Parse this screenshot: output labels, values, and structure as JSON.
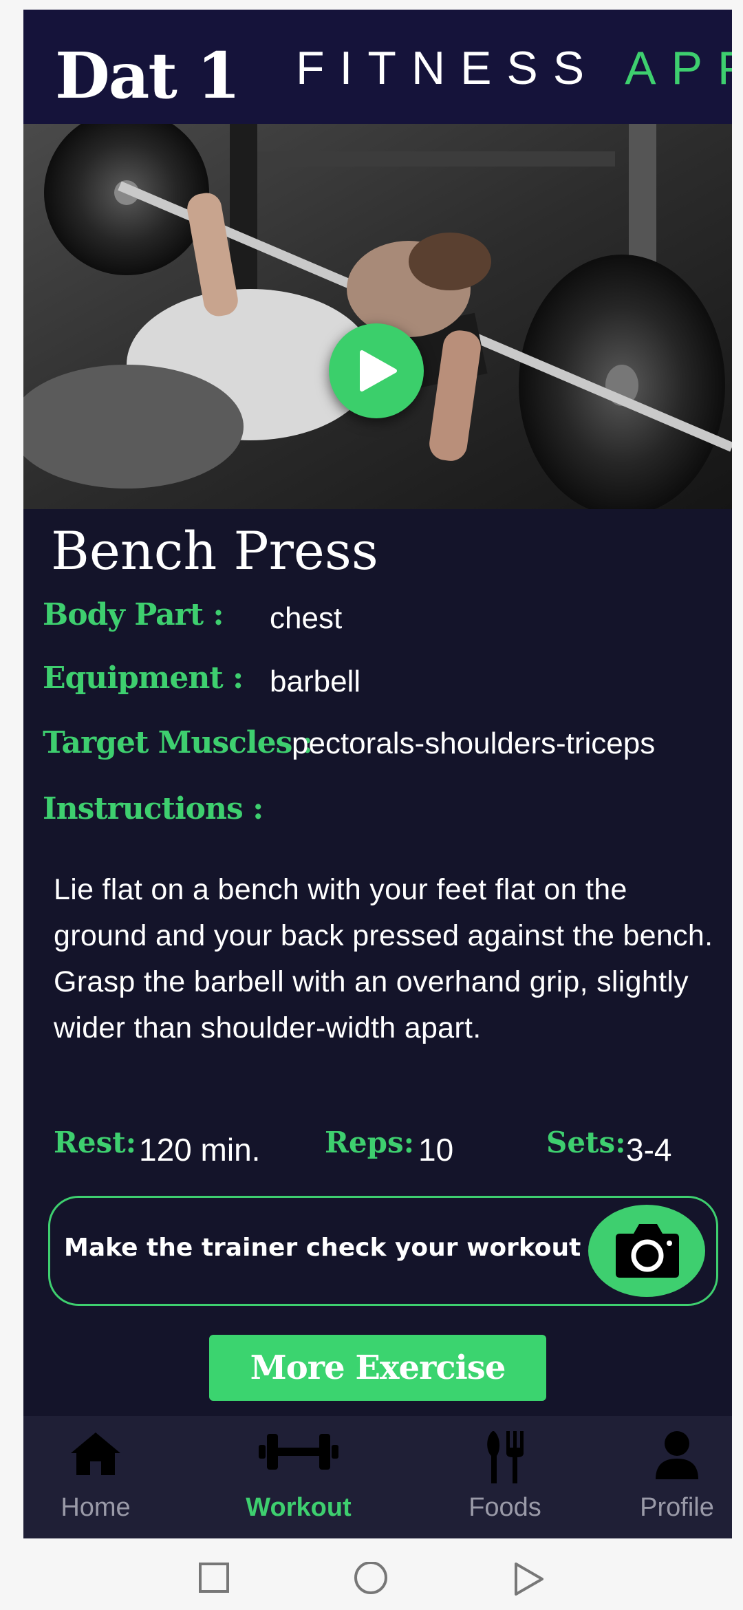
{
  "header": {
    "day_title": "Dat 1",
    "app_title_part1": "FITNESS",
    "app_title_part2": "APP",
    "accent_color": "#3ecf6f"
  },
  "hero": {
    "play_icon": "play-icon"
  },
  "exercise": {
    "name": "Bench Press",
    "body_part_label": "Body Part :",
    "body_part": "chest",
    "equipment_label": "Equipment :",
    "equipment": "barbell",
    "target_label": "Target Muscles :",
    "target": "pectorals-shoulders-triceps",
    "instructions_label": "Instructions :",
    "instructions": [
      "Lie flat on a bench with your feet flat on the ground and your back pressed against the bench.",
      "Grasp the barbell with an overhand grip, slightly wider than shoulder-width apart."
    ],
    "rest_label": "Rest:",
    "rest": "120 min.",
    "reps_label": "Reps:",
    "reps": "10",
    "sets_label": "Sets:",
    "sets": "3-4"
  },
  "trainer": {
    "text": "Make the trainer check your workout",
    "camera_icon": "camera-icon"
  },
  "more_button": "More Exercise",
  "nav": [
    {
      "label": "Home",
      "icon": "home-icon",
      "active": false
    },
    {
      "label": "Workout",
      "icon": "dumbbell-icon",
      "active": true
    },
    {
      "label": "Foods",
      "icon": "fork-knife-icon",
      "active": false
    },
    {
      "label": "Profile",
      "icon": "person-icon",
      "active": false
    }
  ],
  "system_nav": [
    "square-icon",
    "circle-icon",
    "triangle-icon"
  ]
}
